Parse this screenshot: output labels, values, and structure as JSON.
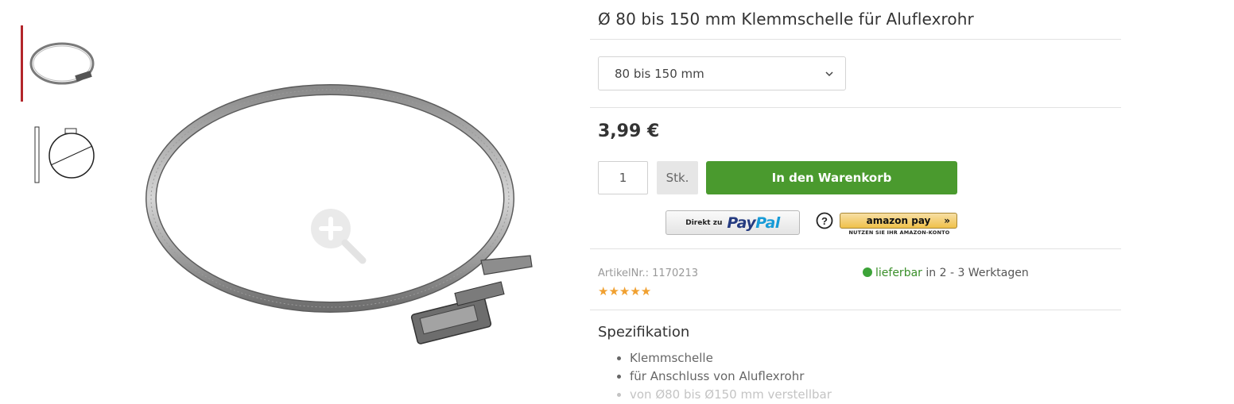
{
  "product": {
    "title": "Ø 80 bis 150 mm Klemmschelle für Aluflexrohr",
    "variant_selected": "80 bis 150 mm",
    "price": "3,99 €"
  },
  "purchase": {
    "quantity": "1",
    "unit": "Stk.",
    "add_to_cart": "In den Warenkorb",
    "paypal_prefix": "Direkt zu",
    "paypal_logo_a": "Pay",
    "paypal_logo_b": "Pal",
    "amazon_pay_label": "amazon pay",
    "amazon_pay_sub": "NUTZEN SIE IHR AMAZON-KONTO",
    "help_glyph": "?"
  },
  "info": {
    "article_number": "ArtikelNr.: 1170213",
    "rating_stars": "★★★★★",
    "rating": 5,
    "availability_status": "lieferbar",
    "availability_time": "in 2 - 3 Werktagen"
  },
  "spec": {
    "title": "Spezifikation",
    "items": [
      "Klemmschelle",
      "für Anschluss von Aluflexrohr",
      "von Ø80 bis Ø150 mm verstellbar"
    ]
  },
  "colors": {
    "accent_red": "#b3262b",
    "cart_green": "#4a9a2e",
    "availability_green": "#3ca338",
    "star_orange": "#f0a030"
  },
  "icons": [
    "zoom-in-icon",
    "chevron-down-icon",
    "help-icon",
    "availability-dot-icon"
  ]
}
